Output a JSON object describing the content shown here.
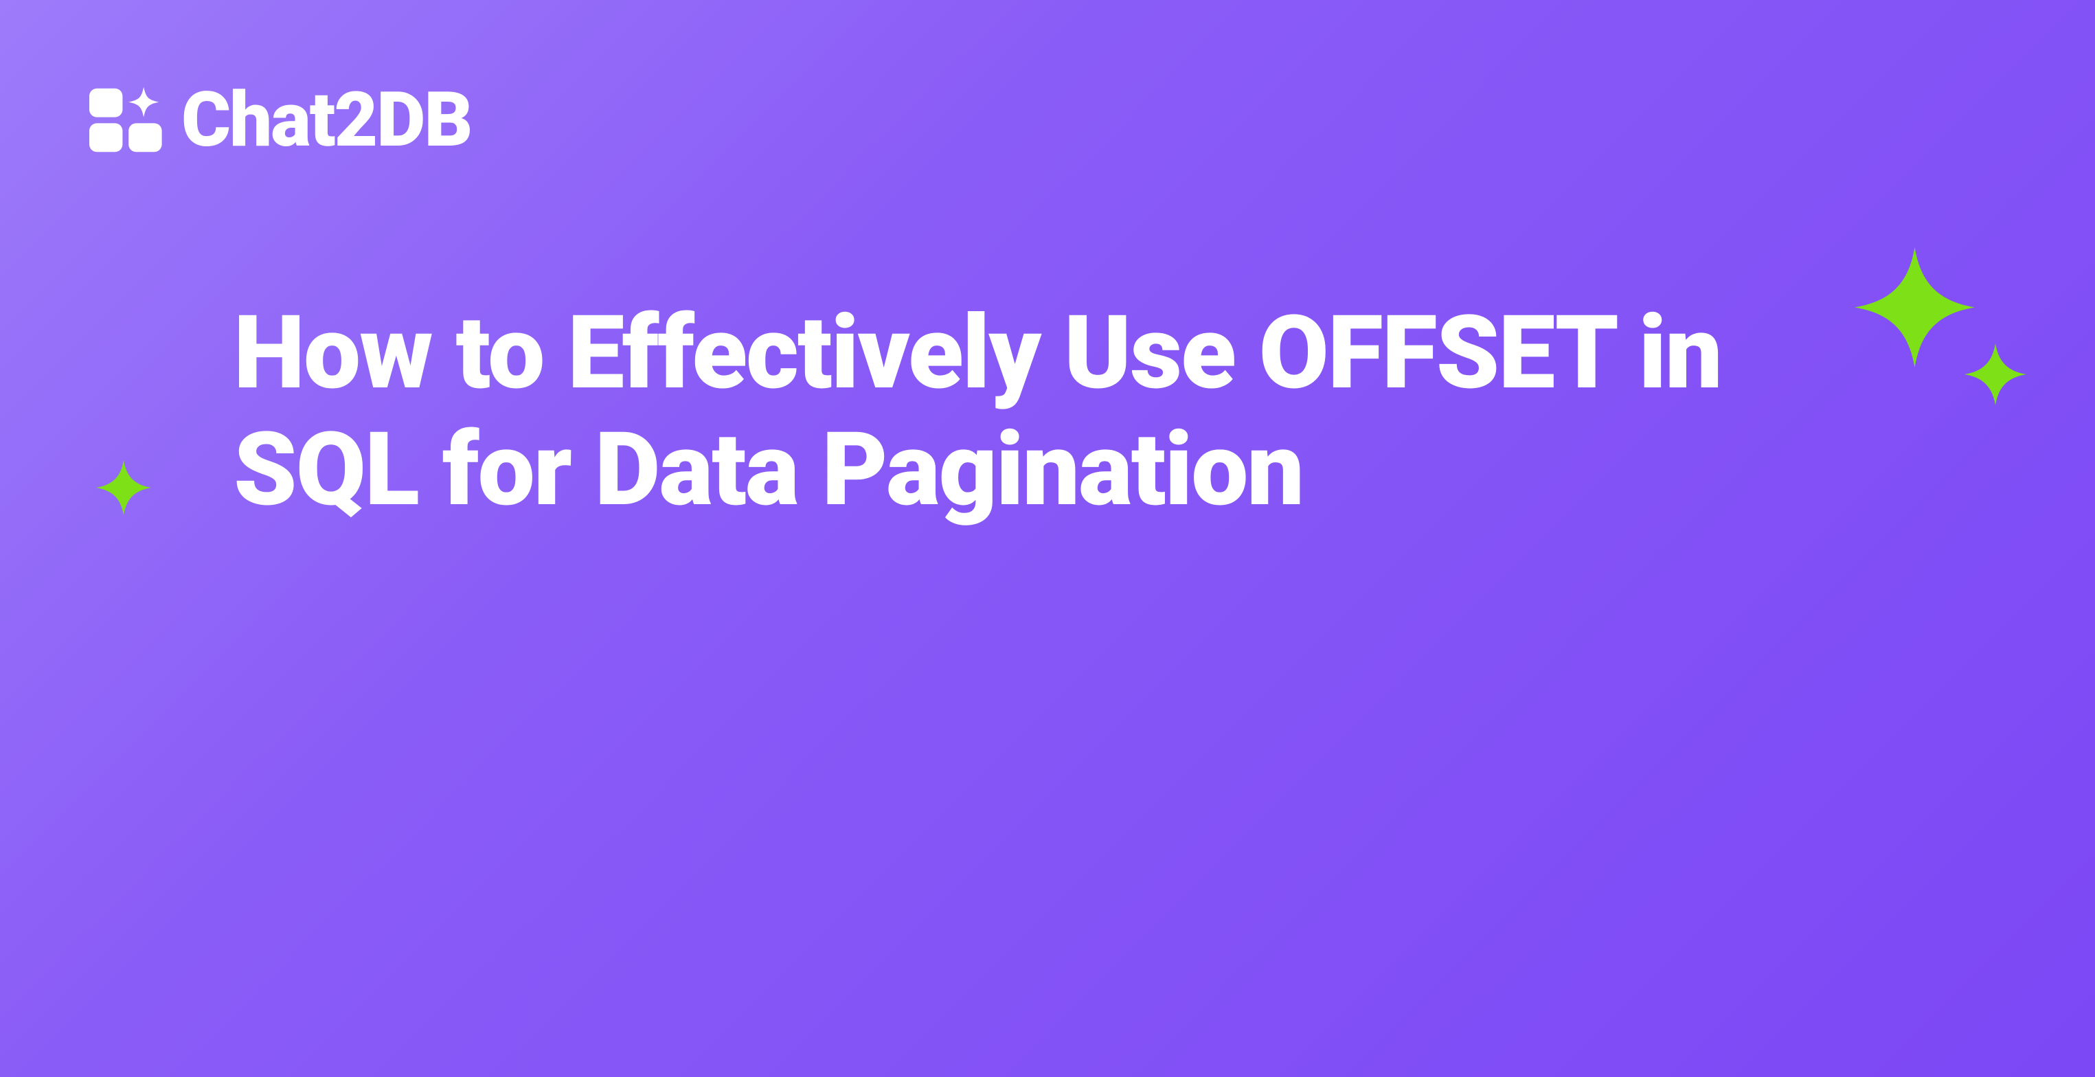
{
  "logo": {
    "brand": "Chat2DB"
  },
  "headline": "How to Effectively Use OFFSET in SQL for Data Pagination",
  "colors": {
    "background_start": "#9d7bfa",
    "background_end": "#7c47f5",
    "text": "#ffffff",
    "accent": "#7ee016"
  }
}
